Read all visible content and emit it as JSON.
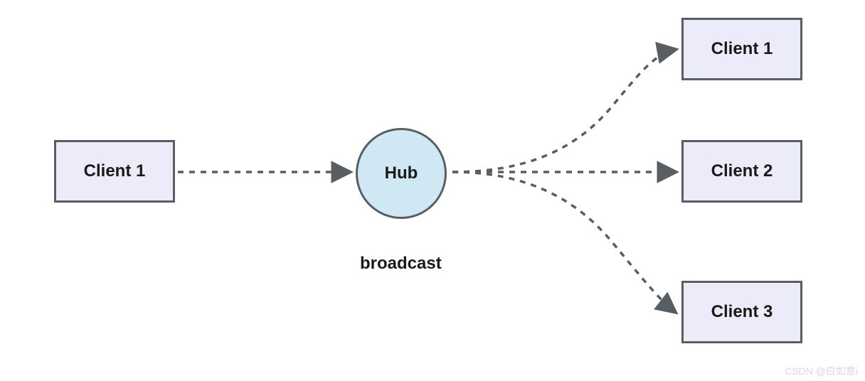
{
  "nodes": {
    "source": {
      "label": "Client 1"
    },
    "hub": {
      "label": "Hub"
    },
    "target1": {
      "label": "Client 1"
    },
    "target2": {
      "label": "Client 2"
    },
    "target3": {
      "label": "Client 3"
    }
  },
  "caption": "broadcast",
  "watermark": "CSDN @白如意i",
  "colors": {
    "box_fill": "#ebebf9",
    "circle_fill": "#d0e7f4",
    "stroke": "#595e62"
  }
}
